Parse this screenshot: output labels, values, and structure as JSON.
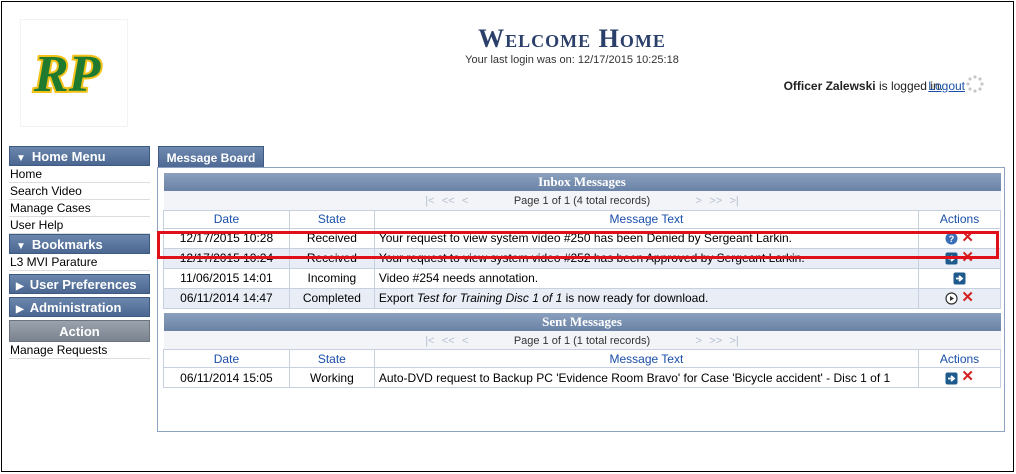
{
  "header": {
    "logo_text": "RP",
    "title": "Welcome Home",
    "last_login": "Your last login was on: 12/17/2015 10:25:18",
    "user_name": "Officer Zalewski",
    "logged_in_suffix": " is logged in.",
    "logout_label": "Logout"
  },
  "sidebar": {
    "home_menu": "Home Menu",
    "home_items": [
      "Home",
      "Search Video",
      "Manage Cases",
      "User Help"
    ],
    "bookmarks": "Bookmarks",
    "bookmark_items": [
      "L3 MVI Parature"
    ],
    "user_preferences": "User Preferences",
    "administration": "Administration",
    "action": "Action",
    "action_items": [
      "Manage Requests"
    ]
  },
  "tab": {
    "label": "Message Board"
  },
  "inbox": {
    "title": "Inbox Messages",
    "pager": "Page 1 of 1 (4 total records)",
    "columns": [
      "Date",
      "State",
      "Message Text",
      "Actions"
    ],
    "rows": [
      {
        "date": "12/17/2015 10:28",
        "state": "Received",
        "text": "Your request to view system video #250 has been Denied by Sergeant Larkin.",
        "actions": [
          "help-icon",
          "delete-icon"
        ]
      },
      {
        "date": "12/17/2015 10:24",
        "state": "Received",
        "text": "Your request to view system video #252 has been Approved by Sergeant Larkin.",
        "actions": [
          "go-icon",
          "delete-icon"
        ]
      },
      {
        "date": "11/06/2015 14:01",
        "state": "Incoming",
        "text": "Video #254 needs annotation.",
        "actions": [
          "go-icon"
        ]
      },
      {
        "date": "06/11/2014 14:47",
        "state": "Completed",
        "text_prefix": "Export ",
        "text_italic": "Test for Training Disc 1 of 1",
        "text_suffix": " is now ready for download.",
        "actions": [
          "play-icon",
          "delete-icon"
        ]
      }
    ]
  },
  "sent": {
    "title": "Sent Messages",
    "pager": "Page 1 of 1 (1 total records)",
    "columns": [
      "Date",
      "State",
      "Message Text",
      "Actions"
    ],
    "rows": [
      {
        "date": "06/11/2014 15:05",
        "state": "Working",
        "text": "Auto-DVD request to Backup PC 'Evidence Room Bravo' for Case 'Bicycle accident' - Disc 1 of 1",
        "actions": [
          "go-icon",
          "delete-icon"
        ]
      }
    ]
  },
  "pager_glyphs": {
    "first": "|<",
    "prev_fast": "<<",
    "prev": "<",
    "next": ">",
    "next_fast": ">>",
    "last": ">|"
  },
  "delete_glyph": "✕",
  "colors": {
    "accent": "#4b6791",
    "highlight": "#e0101a",
    "link": "#1a4fa8",
    "logo_green": "#1f7a2e",
    "logo_yellow": "#f2c21b"
  }
}
